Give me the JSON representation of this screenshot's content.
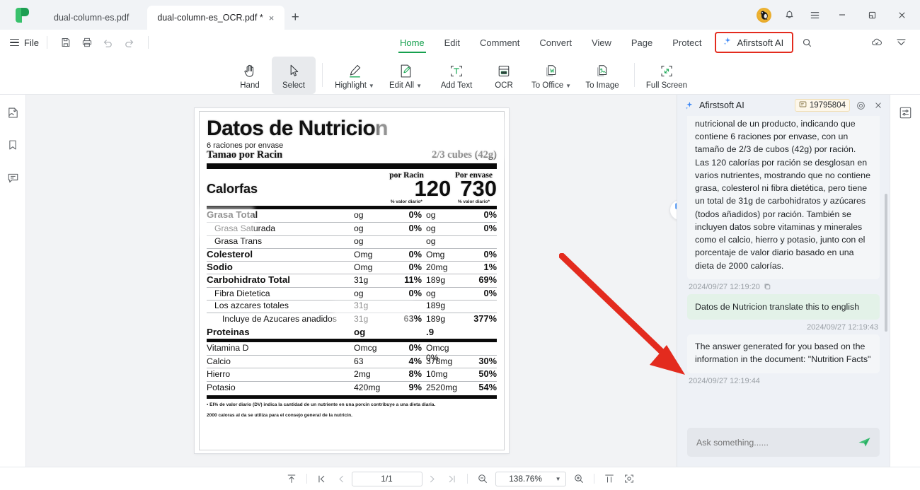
{
  "window": {
    "tabs": [
      {
        "label": "dual-column-es.pdf",
        "active": false
      },
      {
        "label": "dual-column-es_OCR.pdf *",
        "active": true
      }
    ],
    "new_tab_label": "+",
    "close_label": "×",
    "controls": {
      "minimize": "minimize-icon",
      "restore": "restore-icon",
      "close": "close-icon"
    },
    "right_icons": [
      "avatar",
      "bell-icon",
      "menu-icon"
    ]
  },
  "ribbon": {
    "file_label": "File",
    "quick_actions": [
      "save-icon",
      "print-icon",
      "undo-icon",
      "redo-icon"
    ],
    "menu": [
      {
        "label": "Home",
        "active": true
      },
      {
        "label": "Edit",
        "active": false
      },
      {
        "label": "Comment",
        "active": false
      },
      {
        "label": "Convert",
        "active": false
      },
      {
        "label": "View",
        "active": false
      },
      {
        "label": "Page",
        "active": false
      },
      {
        "label": "Protect",
        "active": false
      }
    ],
    "ai_menu_label": "Afirstsoft AI",
    "ai_menu_highlight_color": "#e32b1e",
    "search_icon": "search-icon",
    "right_icons": [
      "cloud-sync-icon",
      "collapse-ribbon-icon"
    ],
    "tools": [
      {
        "label": "Hand",
        "icon": "hand-icon",
        "selected": false,
        "dropdown": false
      },
      {
        "label": "Select",
        "icon": "cursor-icon",
        "selected": true,
        "dropdown": false
      },
      {
        "label": "Highlight",
        "icon": "highlighter-icon",
        "selected": false,
        "dropdown": true
      },
      {
        "label": "Edit All",
        "icon": "edit-document-icon",
        "selected": false,
        "dropdown": true
      },
      {
        "label": "Add Text",
        "icon": "add-text-icon",
        "selected": false,
        "dropdown": false
      },
      {
        "label": "OCR",
        "icon": "ocr-icon",
        "selected": false,
        "dropdown": false
      },
      {
        "label": "To Office",
        "icon": "to-office-icon",
        "selected": false,
        "dropdown": true
      },
      {
        "label": "To Image",
        "icon": "to-image-icon",
        "selected": false,
        "dropdown": false
      },
      {
        "label": "Full Screen",
        "icon": "full-screen-icon",
        "selected": false,
        "dropdown": false
      }
    ]
  },
  "left_rail": [
    {
      "icon": "thumbnail-icon"
    },
    {
      "icon": "bookmark-icon"
    },
    {
      "icon": "comment-icon"
    }
  ],
  "right_rail": [
    {
      "icon": "properties-panel-icon"
    }
  ],
  "viewer": {
    "translate_button_icon": "translate-icon",
    "document": {
      "title": "Datos de Nutricion",
      "servings": "6 raciones por envase",
      "serving_size_label": "Tamao por Racin",
      "serving_size_value": "2/3 cubes (42g)",
      "col_header_1": "por Racin",
      "col_header_2": "Por envase",
      "calories_label": "Calorfas",
      "calories_per_serving": "120",
      "calories_per_container": "730",
      "dv_note_1": "% valor diario*",
      "dv_note_2": "% valor diario*",
      "rows": [
        {
          "name": "Grasa Total",
          "bold": true,
          "indent": 0,
          "a": "og",
          "b": "0%",
          "c": "og",
          "d": "0%"
        },
        {
          "name": "Grasa Saturada",
          "bold": false,
          "indent": 1,
          "a": "og",
          "b": "0%",
          "c": "og",
          "d": "0%"
        },
        {
          "name": "Grasa Trans",
          "bold": false,
          "indent": 1,
          "a": "og",
          "b": "",
          "c": "og",
          "d": ""
        },
        {
          "name": "Colesterol",
          "bold": true,
          "indent": 0,
          "a": "Omg",
          "b": "0%",
          "c": "Omg",
          "d": "0%"
        },
        {
          "name": "Sodio",
          "bold": true,
          "indent": 0,
          "a": "Omg",
          "b": "0%",
          "c": "20mg",
          "d": "1%"
        },
        {
          "name": "Carbohidrato Total",
          "bold": true,
          "indent": 0,
          "a": "31g",
          "b": "11%",
          "c": "189g",
          "d": "69%"
        },
        {
          "name": "Fibra Dietetica",
          "bold": false,
          "indent": 1,
          "a": "og",
          "b": "0%",
          "c": "og",
          "d": "0%"
        },
        {
          "name": "Los azcares totales",
          "bold": false,
          "indent": 1,
          "a": "31g",
          "b": "",
          "c": "189g",
          "d": ""
        },
        {
          "name": "Incluye de Azucares anadidos",
          "bold": false,
          "indent": 2,
          "a": "31g",
          "b": "63%",
          "c": "189g",
          "d": "377%"
        }
      ],
      "protein_label": "Proteinas",
      "protein_a": "og",
      "protein_c": ".9",
      "micros": [
        {
          "name": "Vitamina D",
          "a": "Omcg",
          "b": "0%",
          "c": "Omcg 0%",
          "d": ""
        },
        {
          "name": "Calcio",
          "a": "63",
          "b": "4%",
          "c": "378mg",
          "d": "30%"
        },
        {
          "name": "Hierro",
          "a": "2mg",
          "b": "8%",
          "c": "10mg",
          "d": "50%"
        },
        {
          "name": "Potasio",
          "a": "420mg",
          "b": "9%",
          "c": "2520mg",
          "d": "54%"
        }
      ],
      "footnote_1": "▪ El% de valor diario (DV) indica la cantidad de un nutriente en una porcin contribuye a una dieta diaria.",
      "footnote_2": "2000 caloras al da se utiliza para el consejo general de la nutricin."
    }
  },
  "ai_panel": {
    "title": "Afirstsoft AI",
    "credits": "19795804",
    "credits_icon": "credit-icon",
    "settings_icon": "target-icon",
    "close_icon": "close-icon",
    "messages": [
      {
        "role": "assistant",
        "clipped": true,
        "text": "nutricional de un producto, indicando que contiene 6 raciones por envase, con un tamaño de 2/3 de cubos (42g) por ración. Las 120 calorías por ración se desglosan en varios nutrientes, mostrando que no contiene grasa, colesterol ni fibra dietética, pero tiene un total de 31g de carbohidratos y azúcares (todos añadidos) por ración. También se incluyen datos sobre vitaminas y minerales como el calcio, hierro y potasio, junto con el porcentaje de valor diario basado en una dieta de 2000 calorías.",
        "timestamp": "2024/09/27 12:19:20",
        "timestamp_align": "left",
        "has_copy": true
      },
      {
        "role": "user",
        "clipped": false,
        "text": "Datos de Nutricion translate this to english",
        "timestamp": "2024/09/27 12:19:43",
        "timestamp_align": "right",
        "has_copy": false
      },
      {
        "role": "assistant",
        "clipped": false,
        "text": "The answer generated for you based on the information in the document: \"Nutrition Facts\"",
        "timestamp": "2024/09/27 12:19:44",
        "timestamp_align": "left",
        "has_copy": false
      }
    ],
    "input_placeholder": "Ask something......",
    "input_value": "",
    "send_icon": "send-icon"
  },
  "status_bar": {
    "fit_top_icon": "scroll-to-top-icon",
    "first_page_icon": "first-page-icon",
    "prev_page_icon": "previous-page-icon",
    "page_value": "1/1",
    "next_page_icon": "next-page-icon",
    "last_page_icon": "last-page-icon",
    "zoom_out_icon": "zoom-out-icon",
    "zoom_value": "138.76%",
    "zoom_dropdown_icon": "chevron-down-icon",
    "zoom_in_icon": "zoom-in-icon",
    "fit_width_icon": "fit-width-icon",
    "fit_page_icon": "fit-page-icon"
  },
  "annotation": {
    "arrow_color": "#e32b1e"
  }
}
